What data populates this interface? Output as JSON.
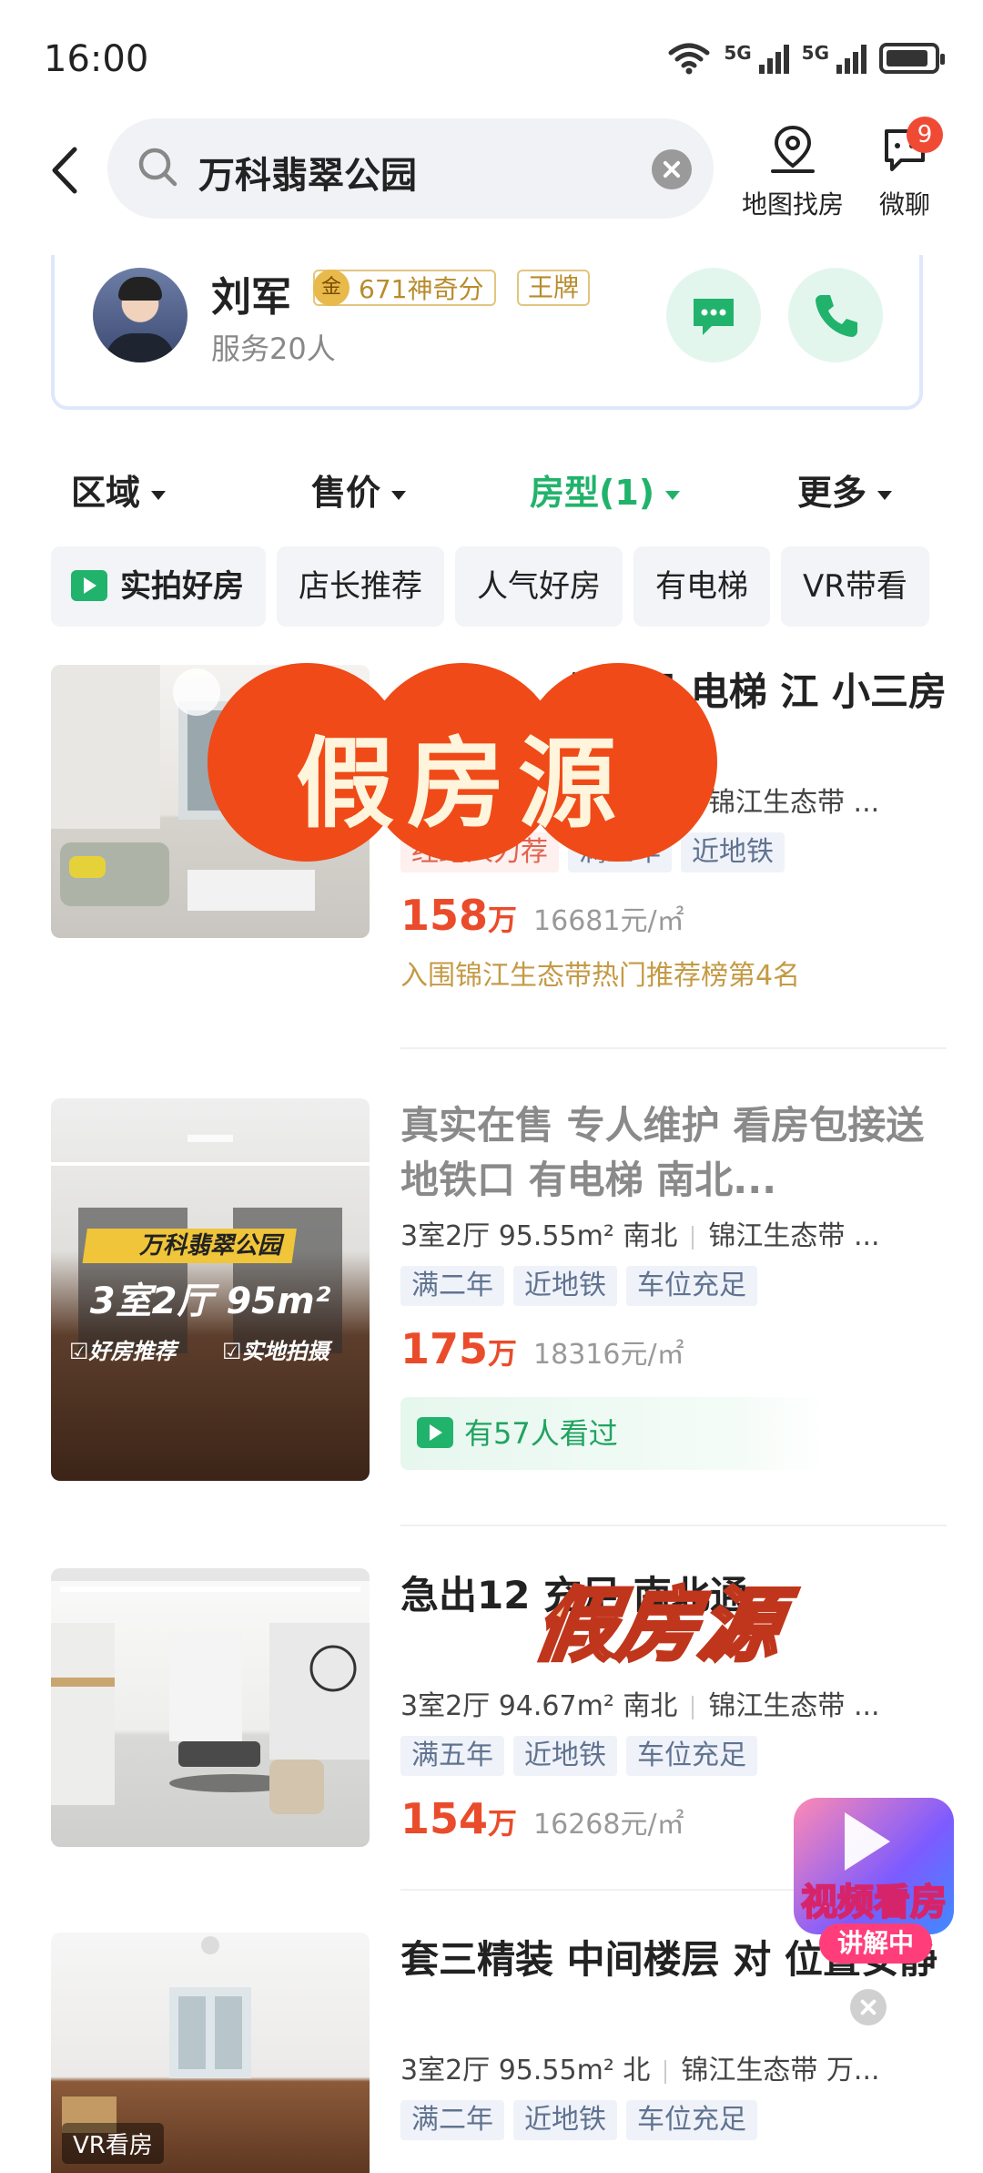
{
  "status_bar": {
    "time": "16:00",
    "net1": "5G",
    "net2": "5G",
    "battery_level": 0.9
  },
  "search": {
    "query": "万科翡翠公园"
  },
  "header": {
    "map_label": "地图找房",
    "chat_label": "微聊",
    "chat_badge": "9"
  },
  "agent": {
    "name": "刘军",
    "medal": "金",
    "score": "671神奇分",
    "rank_badge": "王牌",
    "served": "服务20人"
  },
  "filters": [
    {
      "label": "区域",
      "active": false
    },
    {
      "label": "售价",
      "active": false
    },
    {
      "label": "房型(1)",
      "active": true
    },
    {
      "label": "更多",
      "active": false
    }
  ],
  "quick_tags": [
    "实拍好房",
    "店长推荐",
    "人气好房",
    "有电梯",
    "VR带看"
  ],
  "watermark": "假房源",
  "listings": [
    {
      "title": "位充足 电梯 江  小三房",
      "meta_left": "",
      "area": "锦江生态带",
      "meta_right": "...",
      "tags": [
        "经纪人力荐",
        "满五年",
        "近地铁"
      ],
      "price": "158",
      "price_unit": "万",
      "unit_price": "16681元/㎡",
      "rank": "入围锦江生态带热门推荐榜第4名"
    },
    {
      "title": "真实在售 专人维护 看房包接送 地铁口 有电梯 南北...",
      "meta_left": "3室2厅 95.55m² 南北",
      "area": "锦江生态带",
      "meta_right": "...",
      "tags": [
        "满二年",
        "近地铁",
        "车位充足"
      ],
      "price": "175",
      "price_unit": "万",
      "unit_price": "18316元/㎡",
      "viewed": "有57人看过",
      "image_caption": "万科翡翠公园",
      "image_headline": "3室2厅 95m²",
      "image_check1": "☑好房推荐",
      "image_check2": "☑实地拍摄"
    },
    {
      "title": "急出12 充足 南北通",
      "meta_left": "3室2厅 94.67m² 南北",
      "area": "锦江生态带",
      "meta_right": "...",
      "tags": [
        "满五年",
        "近地铁",
        "车位充足"
      ],
      "price": "154",
      "price_unit": "万",
      "unit_price": "16268元/㎡"
    },
    {
      "title": "套三精装 中间楼层 对 位置安静",
      "meta_left": "3室2厅 95.55m² 北",
      "area": "锦江生态带",
      "meta_right": "万...",
      "tags": [
        "满二年",
        "近地铁",
        "车位充足"
      ],
      "vr_badge": "VR看房"
    }
  ],
  "video_float": {
    "title": "视频看房",
    "live": "讲解中"
  }
}
